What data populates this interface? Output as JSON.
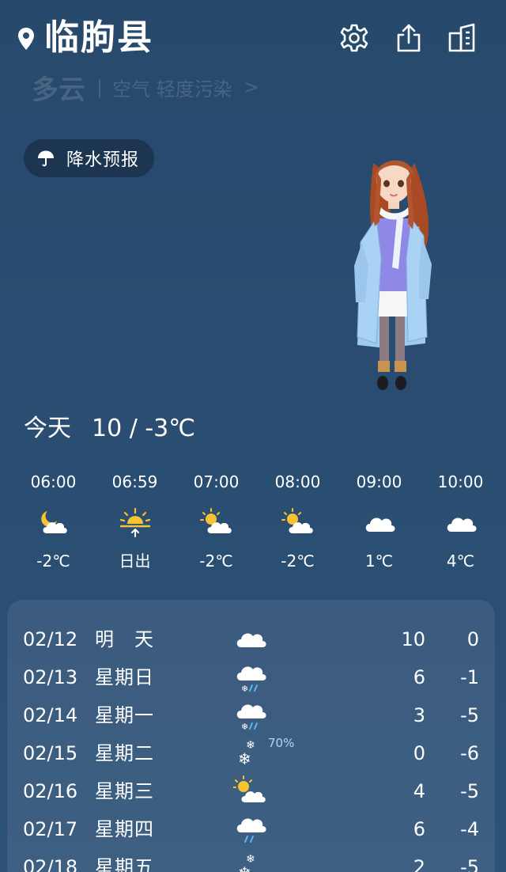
{
  "header": {
    "city": "临朐县",
    "icons": [
      "location-pin-icon",
      "gear-icon",
      "share-icon",
      "city-list-icon"
    ]
  },
  "current": {
    "condition": "多云",
    "separator": "|",
    "air_quality": "空气 轻度污染",
    "aqi_arrow": ">"
  },
  "precip_button": {
    "label": "降水预报",
    "icon": "umbrella-icon"
  },
  "today": {
    "label": "今天",
    "range": "10 / -3℃"
  },
  "hourly": [
    {
      "time": "06:00",
      "icon": "moon-cloud-icon",
      "value": "-2℃"
    },
    {
      "time": "06:59",
      "icon": "sunrise-icon",
      "value": "日出"
    },
    {
      "time": "07:00",
      "icon": "sun-cloud-icon",
      "value": "-2℃"
    },
    {
      "time": "08:00",
      "icon": "sun-cloud-icon",
      "value": "-2℃"
    },
    {
      "time": "09:00",
      "icon": "cloud-icon",
      "value": "1℃"
    },
    {
      "time": "10:00",
      "icon": "cloud-icon",
      "value": "4℃"
    }
  ],
  "daily": [
    {
      "date": "02/12",
      "weekday": "明　天",
      "icon": "cloud-icon",
      "pct": "",
      "hi": "10",
      "lo": "0"
    },
    {
      "date": "02/13",
      "weekday": "星期日",
      "icon": "sleet-icon",
      "pct": "",
      "hi": "6",
      "lo": "-1"
    },
    {
      "date": "02/14",
      "weekday": "星期一",
      "icon": "sleet-icon",
      "pct": "",
      "hi": "3",
      "lo": "-5"
    },
    {
      "date": "02/15",
      "weekday": "星期二",
      "icon": "snow-icon",
      "pct": "70%",
      "hi": "0",
      "lo": "-6"
    },
    {
      "date": "02/16",
      "weekday": "星期三",
      "icon": "sun-cloud-icon",
      "pct": "",
      "hi": "4",
      "lo": "-5"
    },
    {
      "date": "02/17",
      "weekday": "星期四",
      "icon": "rain-icon",
      "pct": "",
      "hi": "6",
      "lo": "-4"
    },
    {
      "date": "02/18",
      "weekday": "星期五",
      "icon": "snow-icon",
      "pct": "",
      "hi": "2",
      "lo": "-5"
    }
  ],
  "colors": {
    "background": "#2a4c70",
    "sun": "#f7c331",
    "rain": "#5fb7f5",
    "panel": "rgba(255,255,255,0.08)"
  }
}
